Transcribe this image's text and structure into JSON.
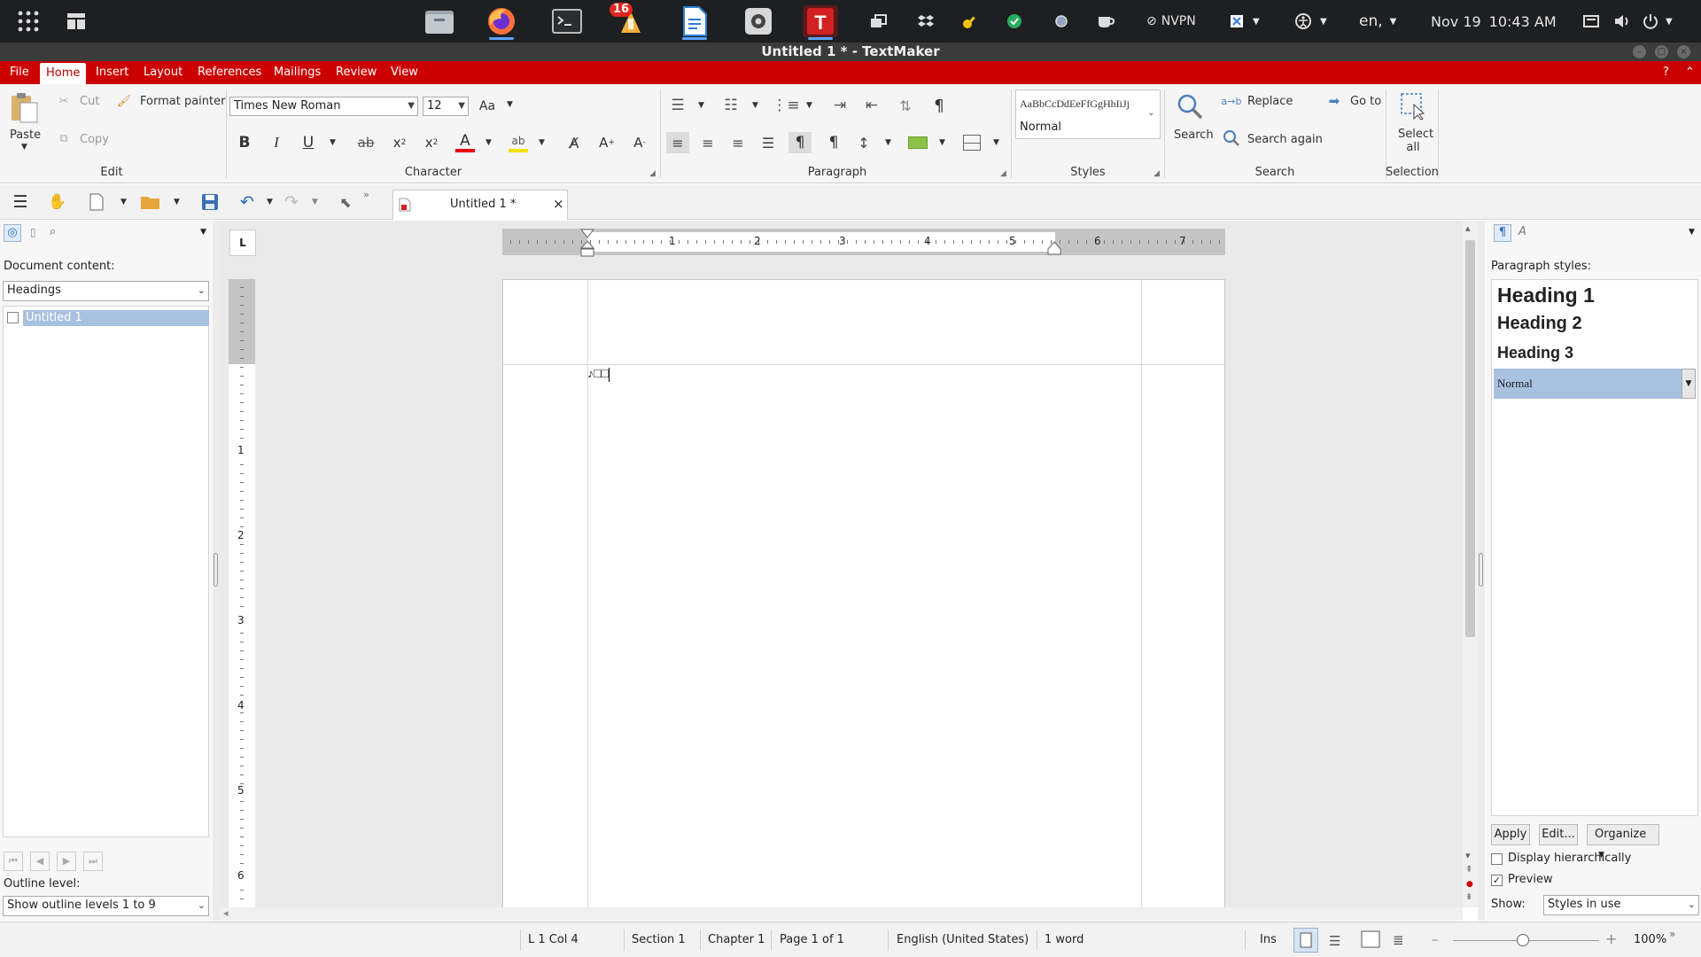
{
  "os": {
    "badge_count": "16",
    "vpn_label": "NVPN",
    "lang": "en,",
    "date": "Nov 19",
    "time": "10:43 AM"
  },
  "window": {
    "title": "Untitled 1 * - TextMaker"
  },
  "menu": {
    "items": [
      "File",
      "Home",
      "Insert",
      "Layout",
      "References",
      "Mailings",
      "Review",
      "View"
    ],
    "help": "?"
  },
  "ribbon": {
    "edit": {
      "paste": "Paste",
      "cut": "Cut",
      "copy": "Copy",
      "format_painter": "Format painter",
      "label": "Edit"
    },
    "character": {
      "font": "Times New Roman",
      "size": "12",
      "label": "Character"
    },
    "paragraph": {
      "label": "Paragraph"
    },
    "styles": {
      "preview": "AaBbCcDdEeFfGgHhIiJj",
      "current": "Normal",
      "label": "Styles"
    },
    "search": {
      "search": "Search",
      "replace": "Replace",
      "search_again": "Search again",
      "goto": "Go to",
      "label": "Search"
    },
    "selection": {
      "select_all_1": "Select",
      "select_all_2": "all",
      "label": "Selection"
    }
  },
  "doc_tab": {
    "title": "Untitled 1 *",
    "close": "×"
  },
  "left_panel": {
    "content_label": "Document content:",
    "content_select": "Headings",
    "tree_item": "Untitled 1",
    "outline_label": "Outline level:",
    "outline_select": "Show outline levels 1 to 9"
  },
  "ruler": {
    "h_ticks": [
      "1",
      "2",
      "3",
      "4",
      "5",
      "6",
      "7"
    ],
    "v_ticks": [
      "1",
      "2",
      "3",
      "4",
      "5",
      "6"
    ]
  },
  "document": {
    "text": "♪□□"
  },
  "right_panel": {
    "label": "Paragraph styles:",
    "styles": [
      "Heading 1",
      "Heading 2",
      "Heading 3"
    ],
    "selected": "Normal",
    "apply": "Apply",
    "edit": "Edit...",
    "organize": "Organize",
    "display_hier": "Display hierarchically",
    "display_hier_checked": false,
    "preview": "Preview",
    "preview_checked": true,
    "show_label": "Show:",
    "show_select": "Styles in use"
  },
  "status": {
    "pos": "L 1 Col 4",
    "section": "Section 1",
    "chapter": "Chapter 1",
    "page": "Page 1 of 1",
    "lang": "English (United States)",
    "words": "1 word",
    "mode": "Ins",
    "zoom": "100%"
  },
  "colors": {
    "accent": "#cc0000",
    "selection": "#a9c1e0",
    "taskbar": "#1e1f21"
  }
}
